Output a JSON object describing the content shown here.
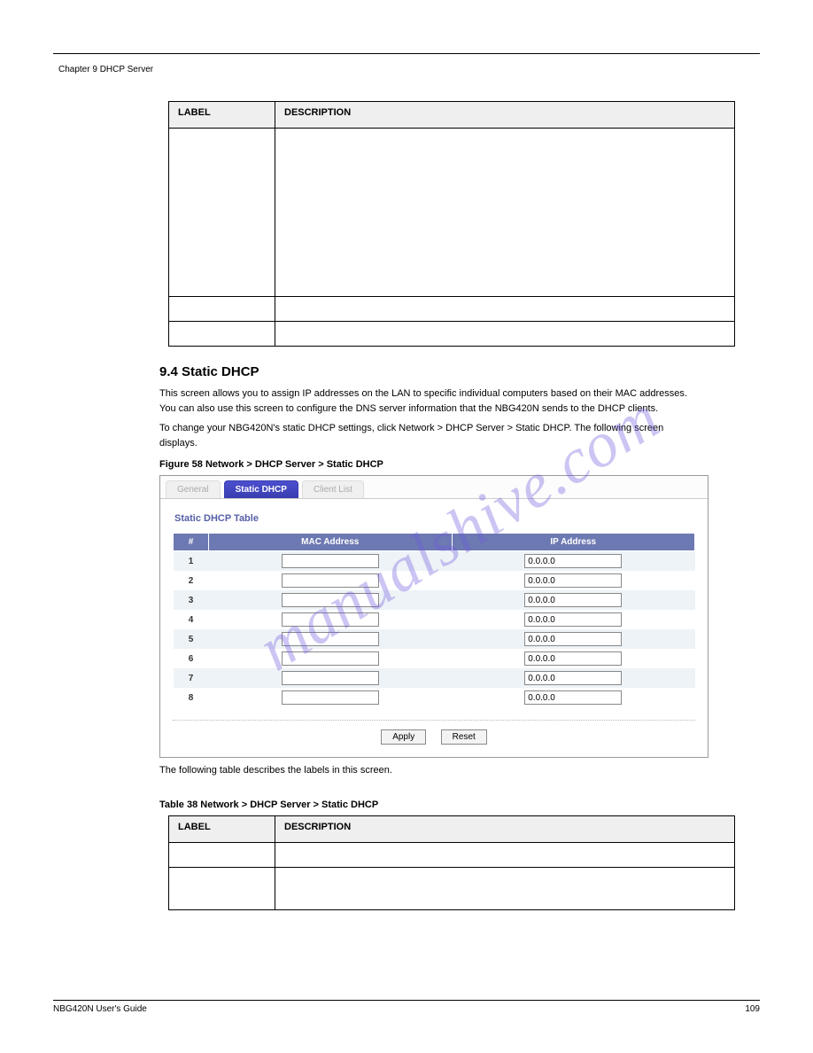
{
  "chapter": "Chapter 9 DHCP Server",
  "table_cont": {
    "caption_implied": true,
    "headers": {
      "label": "LABEL",
      "desc": "DESCRIPTION"
    },
    "rows": [
      {
        "label": "",
        "desc": "",
        "tall": true
      },
      {
        "label": "",
        "desc": ""
      },
      {
        "label": "",
        "desc": ""
      }
    ]
  },
  "section": {
    "heading": "9.4  Static DHCP",
    "para1": "This screen allows you to assign IP addresses on the LAN to specific individual computers based on their MAC addresses. You can also use this screen to configure the DNS server information that the NBG420N sends to the DHCP clients.",
    "para2": "To change your NBG420N's static DHCP settings, click Network > DHCP Server > Static DHCP. The following screen displays."
  },
  "figure": {
    "caption": "Figure 58   Network > DHCP Server > Static DHCP",
    "tabs": [
      {
        "label": "General",
        "active": false
      },
      {
        "label": "Static DHCP",
        "active": true
      },
      {
        "label": "Client List",
        "active": false
      }
    ],
    "panel_title": "Static DHCP Table",
    "columns": {
      "num": "#",
      "mac": "MAC Address",
      "ip": "IP Address"
    },
    "rows": [
      {
        "n": "1",
        "mac": "",
        "ip": "0.0.0.0"
      },
      {
        "n": "2",
        "mac": "",
        "ip": "0.0.0.0"
      },
      {
        "n": "3",
        "mac": "",
        "ip": "0.0.0.0"
      },
      {
        "n": "4",
        "mac": "",
        "ip": "0.0.0.0"
      },
      {
        "n": "5",
        "mac": "",
        "ip": "0.0.0.0"
      },
      {
        "n": "6",
        "mac": "",
        "ip": "0.0.0.0"
      },
      {
        "n": "7",
        "mac": "",
        "ip": "0.0.0.0"
      },
      {
        "n": "8",
        "mac": "",
        "ip": "0.0.0.0"
      }
    ],
    "buttons": {
      "apply": "Apply",
      "reset": "Reset"
    }
  },
  "after_para": "The following table describes the labels in this screen.",
  "table2": {
    "caption": "Table 38   Network > DHCP Server > Static DHCP",
    "headers": {
      "label": "LABEL",
      "desc": "DESCRIPTION"
    },
    "rows": [
      {
        "label": "",
        "desc": ""
      },
      {
        "label": "",
        "desc": "",
        "tall2": true
      }
    ]
  },
  "watermark": "manualshive.com",
  "footer": {
    "left": "NBG420N User's Guide",
    "right": "109"
  }
}
